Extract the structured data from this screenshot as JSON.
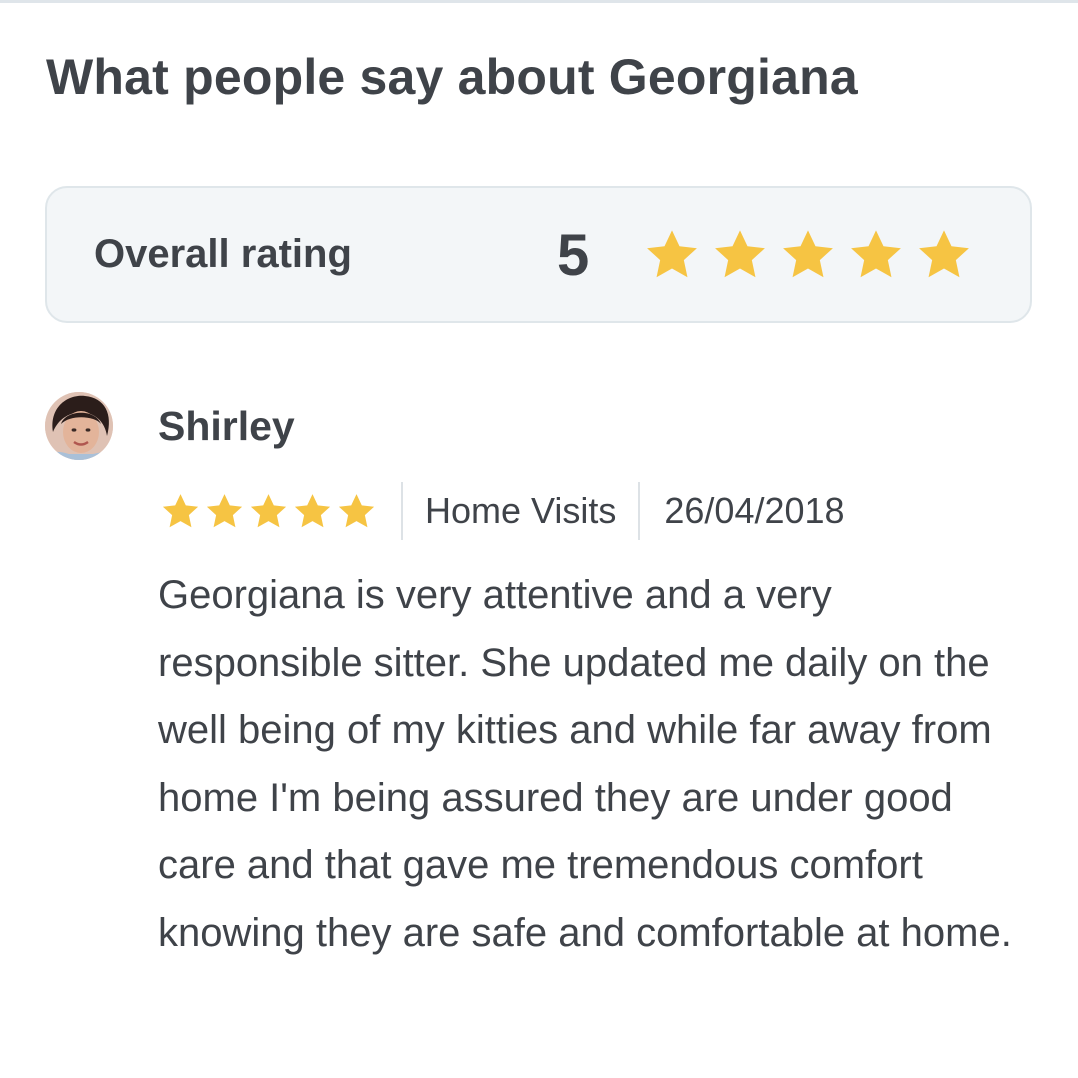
{
  "header": {
    "title": "What people say about Georgiana"
  },
  "overall": {
    "label": "Overall rating",
    "value": "5",
    "stars": 5,
    "star_color": "#f6c443"
  },
  "reviews": [
    {
      "name": "Shirley",
      "stars": 5,
      "service": "Home Visits",
      "date": "26/04/2018",
      "text": "Georgiana is very attentive and a very responsible sitter. She updated me daily on the well being of my kitties and while far away from home I'm being assured they are under good care and that gave me tremendous comfort knowing they are safe and comfortable at home."
    }
  ],
  "colors": {
    "text": "#3f4349",
    "card_bg": "#f3f6f8",
    "card_border": "#dfe6ea",
    "star": "#f6c443"
  }
}
